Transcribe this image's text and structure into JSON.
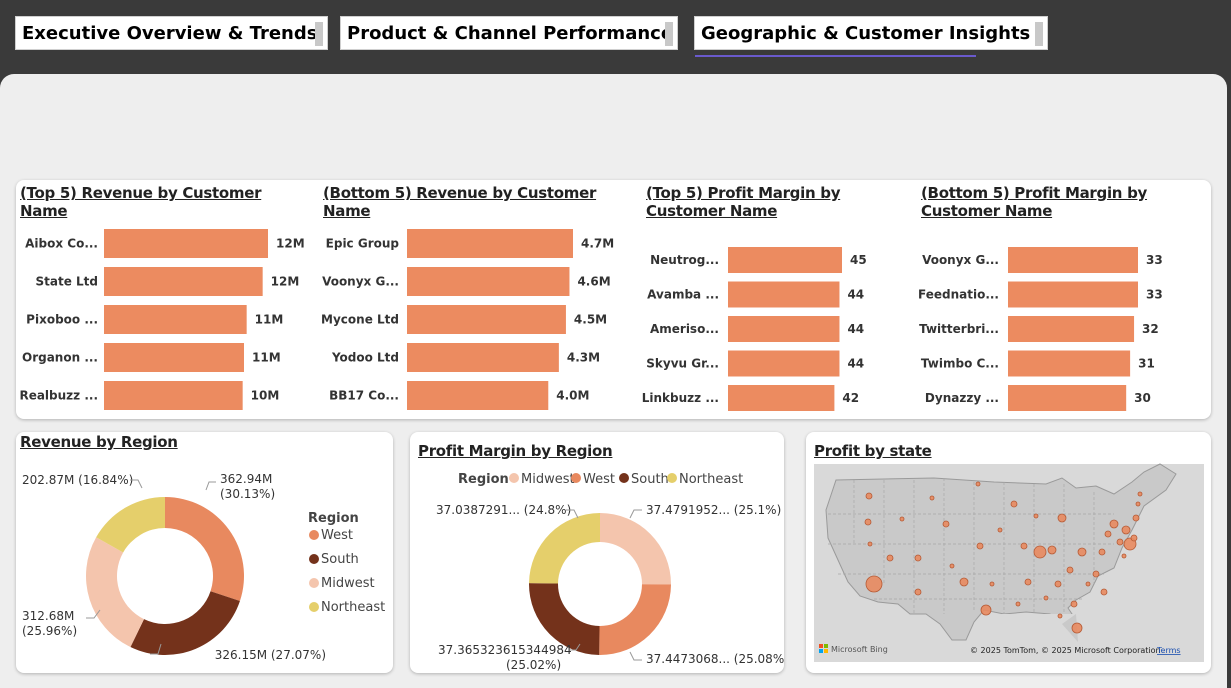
{
  "tabs": [
    {
      "label": "Executive Overview & Trends"
    },
    {
      "label": "Product & Channel Performance"
    },
    {
      "label": "Geographic & Customer Insights"
    }
  ],
  "colors": {
    "west": "#e8895f",
    "south": "#74321b",
    "midwest": "#f4c5ad",
    "northeast": "#e5cf6b",
    "bar": "#ec8b60"
  },
  "chart_data": [
    {
      "type": "bar",
      "orientation": "horizontal",
      "title": "(Top 5) Revenue by Customer Name",
      "categories": [
        "Aibox Co...",
        "State Ltd",
        "Pixoboo ...",
        "Organon ...",
        "Realbuzz ..."
      ],
      "values": [
        12.3,
        11.9,
        10.7,
        10.5,
        10.4
      ],
      "labels": [
        "12M",
        "12M",
        "11M",
        "11M",
        "10M"
      ],
      "xlim": [
        0,
        12.3
      ]
    },
    {
      "type": "bar",
      "orientation": "horizontal",
      "title": "(Bottom 5) Revenue by Customer Name",
      "categories": [
        "Epic Group",
        "Voonyx G...",
        "Mycone Ltd",
        "Yodoo Ltd",
        "BB17 Co..."
      ],
      "values": [
        4.7,
        4.6,
        4.5,
        4.3,
        4.0
      ],
      "labels": [
        "4.7M",
        "4.6M",
        "4.5M",
        "4.3M",
        "4.0M"
      ],
      "xlim": [
        0,
        4.7
      ]
    },
    {
      "type": "bar",
      "orientation": "horizontal",
      "title": "(Top 5) Profit Margin by Customer Name",
      "categories": [
        "Neutrog...",
        "Avamba ...",
        "Ameriso...",
        "Skyvu Gr...",
        "Linkbuzz ..."
      ],
      "values": [
        45,
        44,
        44,
        44,
        42
      ],
      "labels": [
        "45",
        "44",
        "44",
        "44",
        "42"
      ],
      "xlim": [
        0,
        45
      ]
    },
    {
      "type": "bar",
      "orientation": "horizontal",
      "title": "(Bottom 5) Profit Margin by Customer Name",
      "categories": [
        "Voonyx G...",
        "Feednatio...",
        "Twitterbri...",
        "Twimbo C...",
        "Dynazzy ..."
      ],
      "values": [
        33,
        33,
        32,
        31,
        30
      ],
      "labels": [
        "33",
        "33",
        "32",
        "31",
        "30"
      ],
      "xlim": [
        0,
        33
      ]
    },
    {
      "type": "pie",
      "donut": true,
      "title": "Revenue by Region",
      "legend_title": "Region",
      "legend_position": "right",
      "slices": [
        {
          "name": "West",
          "value": 362.94,
          "label_a": "362.94M",
          "label_b": "(30.13%)"
        },
        {
          "name": "South",
          "value": 326.15,
          "label_a": "326.15M (27.07%)",
          "label_b": ""
        },
        {
          "name": "Midwest",
          "value": 312.68,
          "label_a": "312.68M",
          "label_b": "(25.96%)"
        },
        {
          "name": "Northeast",
          "value": 202.87,
          "label_a": "202.87M (16.84%)",
          "label_b": ""
        }
      ]
    },
    {
      "type": "pie",
      "donut": true,
      "title": "Profit Margin by Region",
      "legend_title": "Region",
      "legend_position": "top",
      "slices": [
        {
          "name": "Midwest",
          "value": 37.4791952,
          "label_a": "37.4791952... (25.1%)",
          "label_b": ""
        },
        {
          "name": "West",
          "value": 37.4473068,
          "label_a": "37.4473068... (25.08%)",
          "label_b": ""
        },
        {
          "name": "South",
          "value": 37.365323615344984,
          "label_a": "37.365323615344984",
          "label_b": "(25.02%)"
        },
        {
          "name": "Northeast",
          "value": 37.0387291,
          "label_a": "37.0387291... (24.8%)",
          "label_b": ""
        }
      ]
    }
  ],
  "map": {
    "title": "Profit by state",
    "bing_label": "Microsoft Bing",
    "copyright": "© 2025 TomTom, © 2025 Microsoft Corporation",
    "terms": "Terms"
  }
}
